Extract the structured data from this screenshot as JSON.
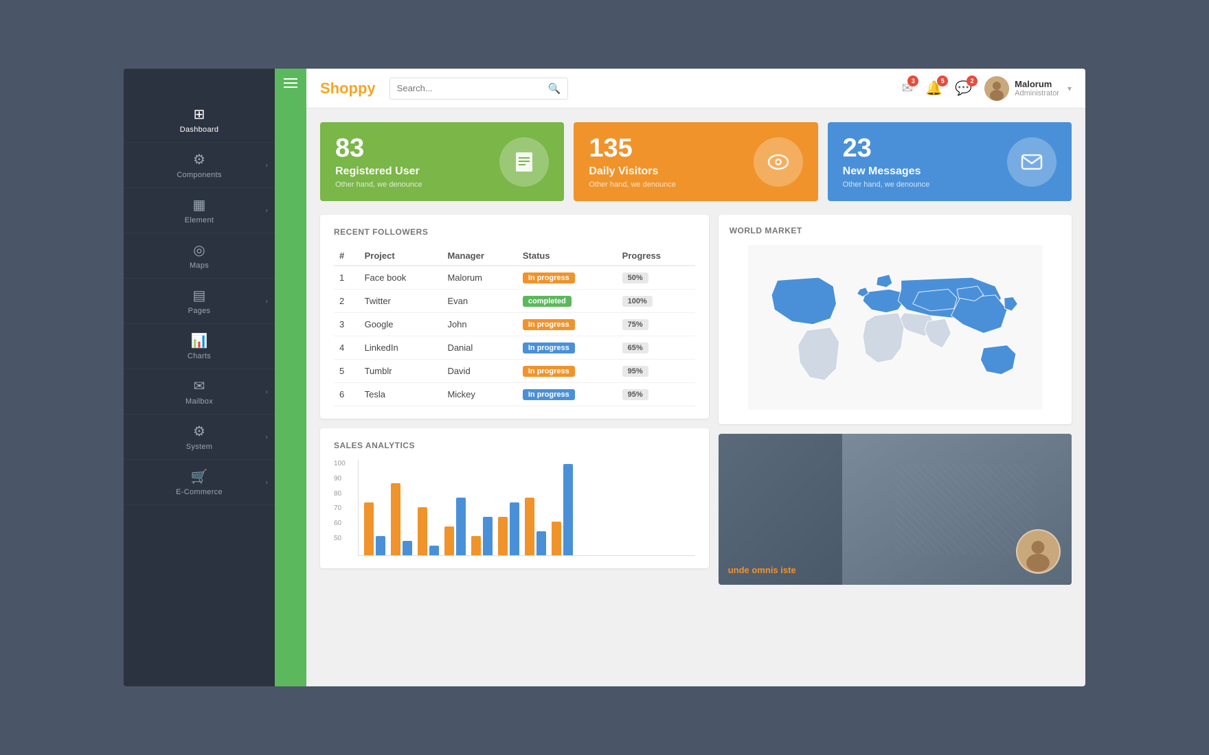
{
  "brand": "Shoppy",
  "search": {
    "placeholder": "Search..."
  },
  "header": {
    "notifications_email_count": "3",
    "notifications_bell_count": "5",
    "notifications_chat_count": "2",
    "user_name": "Malorum",
    "user_role": "Administrator"
  },
  "sidebar": {
    "items": [
      {
        "id": "dashboard",
        "label": "Dashboard",
        "icon": "⊞",
        "has_sub": false
      },
      {
        "id": "components",
        "label": "Components",
        "icon": "⚙",
        "has_sub": true
      },
      {
        "id": "element",
        "label": "Element",
        "icon": "▦",
        "has_sub": true
      },
      {
        "id": "maps",
        "label": "Maps",
        "icon": "◎",
        "has_sub": false
      },
      {
        "id": "pages",
        "label": "Pages",
        "icon": "▤",
        "has_sub": true
      },
      {
        "id": "charts",
        "label": "Charts",
        "icon": "▦",
        "has_sub": false
      },
      {
        "id": "mailbox",
        "label": "Mailbox",
        "icon": "✉",
        "has_sub": true
      },
      {
        "id": "system",
        "label": "System",
        "icon": "⚙",
        "has_sub": true
      },
      {
        "id": "ecommerce",
        "label": "E-Commerce",
        "icon": "🛒",
        "has_sub": true
      }
    ]
  },
  "stat_cards": [
    {
      "number": "83",
      "title": "Registered User",
      "subtitle": "Other hand, we denounce",
      "color": "green",
      "icon": "📋"
    },
    {
      "number": "135",
      "title": "Daily Visitors",
      "subtitle": "Other hand, we denounce",
      "color": "orange",
      "icon": "👁"
    },
    {
      "number": "23",
      "title": "New Messages",
      "subtitle": "Other hand, we denounce",
      "color": "blue",
      "icon": "✉"
    }
  ],
  "recent_followers": {
    "title": "RECENT FOLLOWERS",
    "columns": [
      "#",
      "Project",
      "Manager",
      "Status",
      "Progress"
    ],
    "rows": [
      {
        "num": "1",
        "project": "Face book",
        "manager": "Malorum",
        "status": "In progress",
        "status_color": "orange",
        "progress": "50%"
      },
      {
        "num": "2",
        "project": "Twitter",
        "manager": "Evan",
        "status": "completed",
        "status_color": "green",
        "progress": "100%"
      },
      {
        "num": "3",
        "project": "Google",
        "manager": "John",
        "status": "In progress",
        "status_color": "orange",
        "progress": "75%"
      },
      {
        "num": "4",
        "project": "LinkedIn",
        "manager": "Danial",
        "status": "In progress",
        "status_color": "blue",
        "progress": "65%"
      },
      {
        "num": "5",
        "project": "Tumblr",
        "manager": "David",
        "status": "In progress",
        "status_color": "orange",
        "progress": "95%"
      },
      {
        "num": "6",
        "project": "Tesla",
        "manager": "Mickey",
        "status": "In progress",
        "status_color": "blue",
        "progress": "95%"
      }
    ]
  },
  "world_market": {
    "title": "WORLD MARKET"
  },
  "sales_analytics": {
    "title": "SALES ANALYTICS",
    "y_labels": [
      "100",
      "90",
      "80",
      "70",
      "60",
      "50"
    ],
    "bars": [
      {
        "orange": 55,
        "blue": 20
      },
      {
        "orange": 75,
        "blue": 15
      },
      {
        "orange": 50,
        "blue": 10
      },
      {
        "orange": 30,
        "blue": 60
      },
      {
        "orange": 20,
        "blue": 40
      },
      {
        "orange": 40,
        "blue": 55
      },
      {
        "orange": 60,
        "blue": 25
      },
      {
        "orange": 35,
        "blue": 95
      }
    ]
  },
  "promo": {
    "title": "unde omnis iste"
  }
}
